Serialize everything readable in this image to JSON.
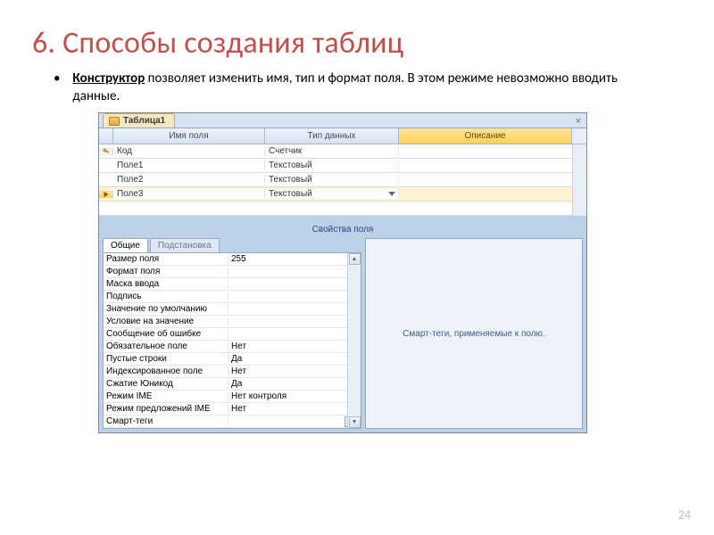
{
  "slide": {
    "title": "6. Способы создания таблиц",
    "page_number": "24",
    "bullet_lead": "Конструктор",
    "bullet_rest": " позволяет изменить имя, тип и формат поля. В этом режиме невозможно вводить данные."
  },
  "app": {
    "tab_label": "Таблица1",
    "close_glyph": "×",
    "columns": {
      "c1": "Имя поля",
      "c2": "Тип данных",
      "c3": "Описание"
    },
    "rows": [
      {
        "name": "Код",
        "type": "Счетчик",
        "key": true
      },
      {
        "name": "Поле1",
        "type": "Текстовый"
      },
      {
        "name": "Поле2",
        "type": "Текстовый"
      },
      {
        "name": "Поле3",
        "type": "Текстовый",
        "selected": true,
        "dropdown": true
      }
    ],
    "props_section_label": "Свойства поля",
    "ptabs": {
      "general": "Общие",
      "lookup": "Подстановка"
    },
    "properties": [
      {
        "k": "Размер поля",
        "v": "255"
      },
      {
        "k": "Формат поля",
        "v": ""
      },
      {
        "k": "Маска ввода",
        "v": ""
      },
      {
        "k": "Подпись",
        "v": ""
      },
      {
        "k": "Значение по умолчанию",
        "v": ""
      },
      {
        "k": "Условие на значение",
        "v": ""
      },
      {
        "k": "Сообщение об ошибке",
        "v": ""
      },
      {
        "k": "Обязательное поле",
        "v": "Нет"
      },
      {
        "k": "Пустые строки",
        "v": "Да"
      },
      {
        "k": "Индексированное поле",
        "v": "Нет"
      },
      {
        "k": "Сжатие Юникод",
        "v": "Да"
      },
      {
        "k": "Режим IME",
        "v": "Нет контроля"
      },
      {
        "k": "Режим предложений IME",
        "v": "Нет"
      },
      {
        "k": "Смарт-теги",
        "v": ""
      }
    ],
    "help_text": "Смарт-теги, применяемые к полю.",
    "ellipsis": "..."
  }
}
